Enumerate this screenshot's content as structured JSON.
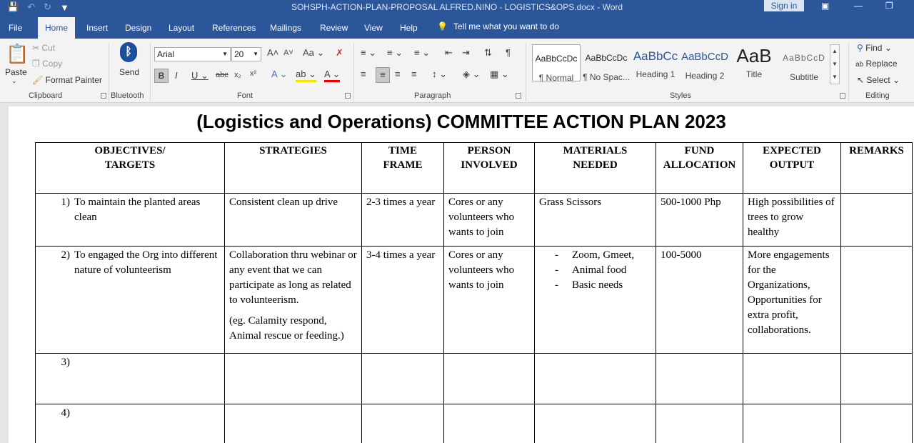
{
  "titlebar": {
    "document_title": "SOHSPH-ACTION-PLAN-PROPOSAL ALFRED.NINO - LOGISTICS&OPS.docx  -  Word",
    "sign_in": "Sign in"
  },
  "tabs": [
    "File",
    "Home",
    "Insert",
    "Design",
    "Layout",
    "References",
    "Mailings",
    "Review",
    "View",
    "Help"
  ],
  "tell_me": "Tell me what you want to do",
  "ribbon": {
    "clipboard": {
      "paste": "Paste",
      "cut": "Cut",
      "copy": "Copy",
      "format_painter": "Format Painter",
      "label": "Clipboard"
    },
    "bluetooth": {
      "send": "Send",
      "label": "Bluetooth"
    },
    "font": {
      "family": "Arial",
      "size": "20",
      "label": "Font",
      "case_btn": "Aa"
    },
    "paragraph": {
      "label": "Paragraph"
    },
    "styles": {
      "label": "Styles",
      "items": [
        {
          "preview": "AaBbCcDc",
          "name": "¶ Normal"
        },
        {
          "preview": "AaBbCcDc",
          "name": "¶ No Spac..."
        },
        {
          "preview": "AaBbCc",
          "name": "Heading 1"
        },
        {
          "preview": "AaBbCcD",
          "name": "Heading 2"
        },
        {
          "preview": "AaB",
          "name": "Title"
        },
        {
          "preview": "AaBbCcD",
          "name": "Subtitle"
        }
      ]
    },
    "editing": {
      "find": "Find",
      "replace": "Replace",
      "select": "Select",
      "label": "Editing"
    }
  },
  "document": {
    "heading": "(Logistics and Operations) COMMITTEE ACTION PLAN 2023",
    "columns": [
      "OBJECTIVES/\nTARGETS",
      "STRATEGIES",
      "TIME\nFRAME",
      "PERSON\nINVOLVED",
      "MATERIALS\nNEEDED",
      "FUND\nALLOCATION",
      "EXPECTED\nOUTPUT",
      "REMARKS"
    ],
    "rows": [
      {
        "num": "1)",
        "objective": "To maintain the planted areas clean",
        "strategy": "Consistent clean up drive",
        "strategy_note": "",
        "time_frame": "2-3 times a year",
        "persons": "Cores or any volunteers who wants to join",
        "materials": [
          "Grass Scissors"
        ],
        "fund": "500-1000 Php",
        "output": "High possibilities of trees to grow healthy",
        "remarks": ""
      },
      {
        "num": "2)",
        "objective": "To engaged the Org into different nature of volunteerism",
        "strategy": "Collaboration thru webinar or any event that we can participate as long as related to volunteerism.",
        "strategy_note": "(eg. Calamity respond, Animal rescue or feeding.)",
        "time_frame": "3-4 times a year",
        "persons": "Cores or any volunteers who wants to join",
        "materials": [
          "Zoom, Gmeet,",
          "Animal food",
          "Basic needs"
        ],
        "fund": "100-5000",
        "output": "More engagements for the Organizations, Opportunities for extra profit, collaborations.",
        "remarks": ""
      },
      {
        "num": "3)"
      },
      {
        "num": "4)"
      }
    ]
  }
}
